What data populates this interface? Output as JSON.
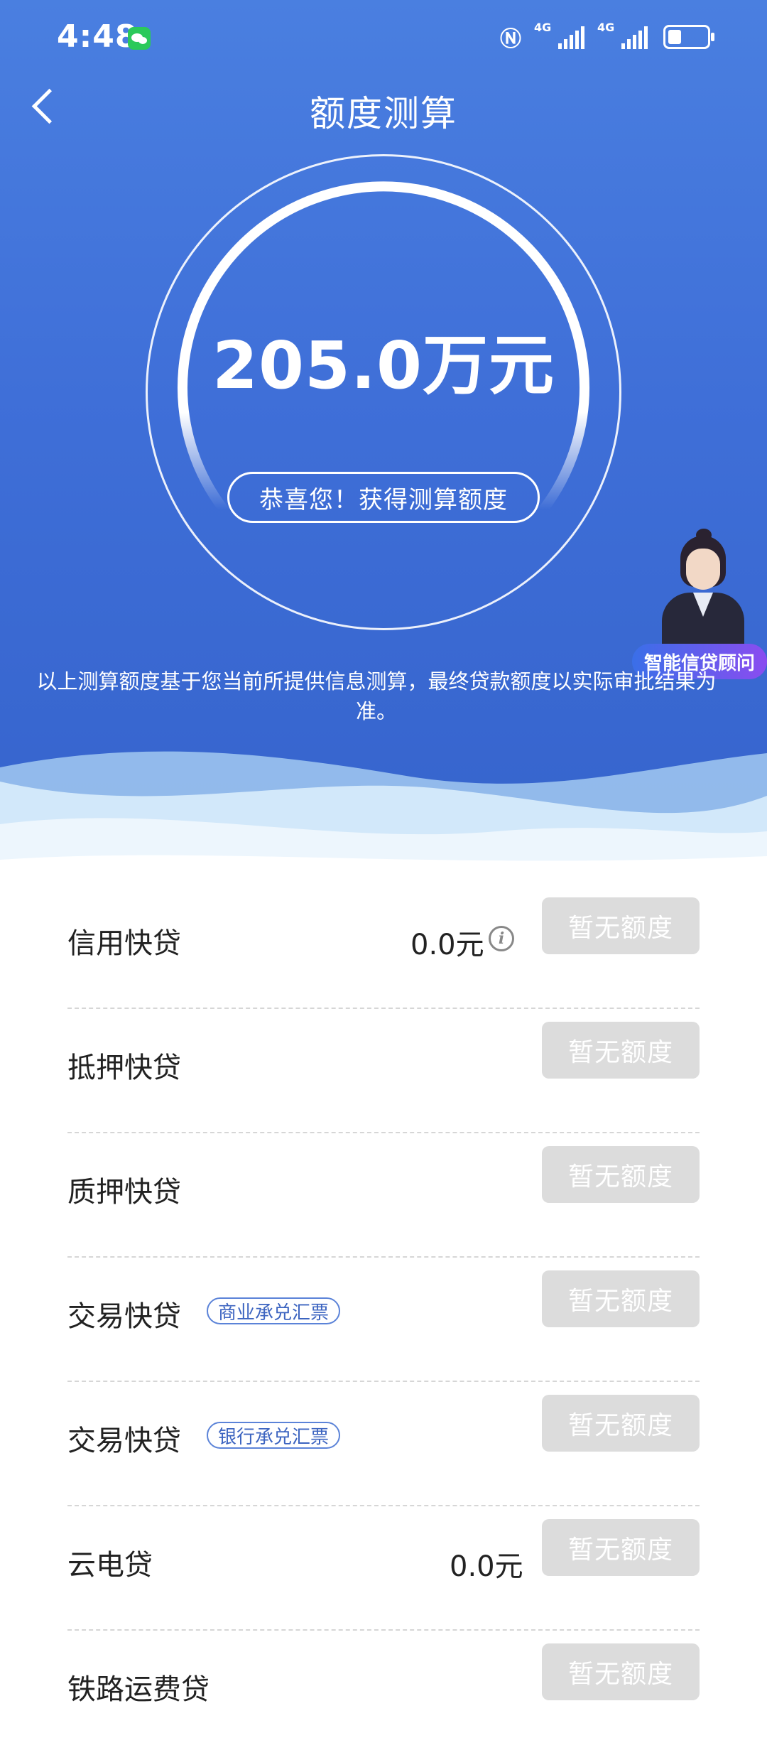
{
  "status_bar": {
    "time": "4:48",
    "net1": "4G",
    "net2": "4G"
  },
  "header": {
    "title": "额度测算"
  },
  "result": {
    "amount": "205.0万元",
    "congrats": "恭喜您！获得测算额度",
    "disclaimer": "以上测算额度基于您当前所提供信息测算，最终贷款额度以实际审批结果为准。"
  },
  "advisor": {
    "label": "智能信贷顾问"
  },
  "products": [
    {
      "name": "信用快贷",
      "tag": "",
      "value": "0.0元",
      "button": "暂无额度"
    },
    {
      "name": "抵押快贷",
      "tag": "",
      "value": "",
      "button": "暂无额度"
    },
    {
      "name": "质押快贷",
      "tag": "",
      "value": "",
      "button": "暂无额度"
    },
    {
      "name": "交易快贷",
      "tag": "商业承兑汇票",
      "value": "",
      "button": "暂无额度"
    },
    {
      "name": "交易快贷",
      "tag": "银行承兑汇票",
      "value": "",
      "button": "暂无额度"
    },
    {
      "name": "云电贷",
      "tag": "",
      "value": "0.0元",
      "button": "暂无额度"
    },
    {
      "name": "铁路运费贷",
      "tag": "",
      "value": "",
      "button": "暂无额度"
    }
  ]
}
